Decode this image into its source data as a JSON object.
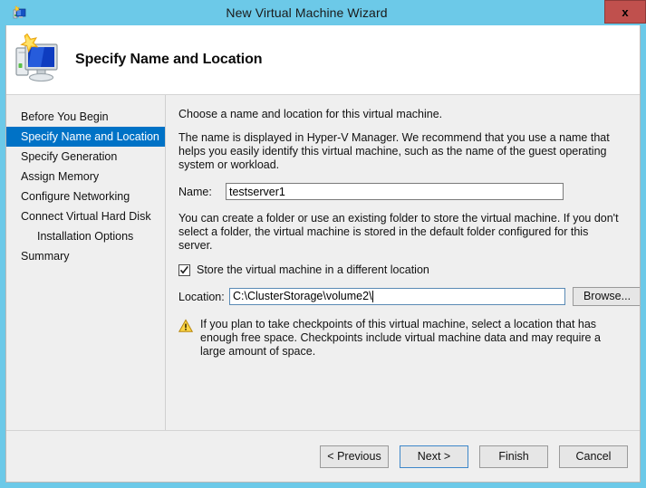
{
  "window": {
    "title": "New Virtual Machine Wizard",
    "title_icon": "vm-wizard-icon",
    "close_label": "x",
    "accent_color": "#6cc9e8",
    "close_color": "#c0504d"
  },
  "banner": {
    "heading": "Specify Name and Location",
    "icon": "vm-monitor-icon"
  },
  "sidebar": {
    "items": [
      {
        "label": "Before You Begin",
        "selected": false,
        "indent": false
      },
      {
        "label": "Specify Name and Location",
        "selected": true,
        "indent": false
      },
      {
        "label": "Specify Generation",
        "selected": false,
        "indent": false
      },
      {
        "label": "Assign Memory",
        "selected": false,
        "indent": false
      },
      {
        "label": "Configure Networking",
        "selected": false,
        "indent": false
      },
      {
        "label": "Connect Virtual Hard Disk",
        "selected": false,
        "indent": false
      },
      {
        "label": "Installation Options",
        "selected": false,
        "indent": true
      },
      {
        "label": "Summary",
        "selected": false,
        "indent": false
      }
    ],
    "selected_color": "#0072c6"
  },
  "content": {
    "intro": "Choose a name and location for this virtual machine.",
    "description": "The name is displayed in Hyper-V Manager. We recommend that you use a name that helps you easily identify this virtual machine, such as the name of the guest operating system or workload.",
    "name_label": "Name:",
    "name_value": "testserver1",
    "folder_description": "You can create a folder or use an existing folder to store the virtual machine. If you don't select a folder, the virtual machine is stored in the default folder configured for this server.",
    "checkbox_label": "Store the virtual machine in a different location",
    "checkbox_checked": true,
    "location_label": "Location:",
    "location_value": "C:\\ClusterStorage\\volume2\\",
    "browse_label": "Browse...",
    "warning_icon": "warning-triangle-icon",
    "warning_text": "If you plan to take checkpoints of this virtual machine, select a location that has enough free space. Checkpoints include virtual machine data and may require a large amount of space."
  },
  "footer": {
    "previous_label": "< Previous",
    "next_label": "Next >",
    "finish_label": "Finish",
    "cancel_label": "Cancel",
    "default_button": "Next >"
  }
}
